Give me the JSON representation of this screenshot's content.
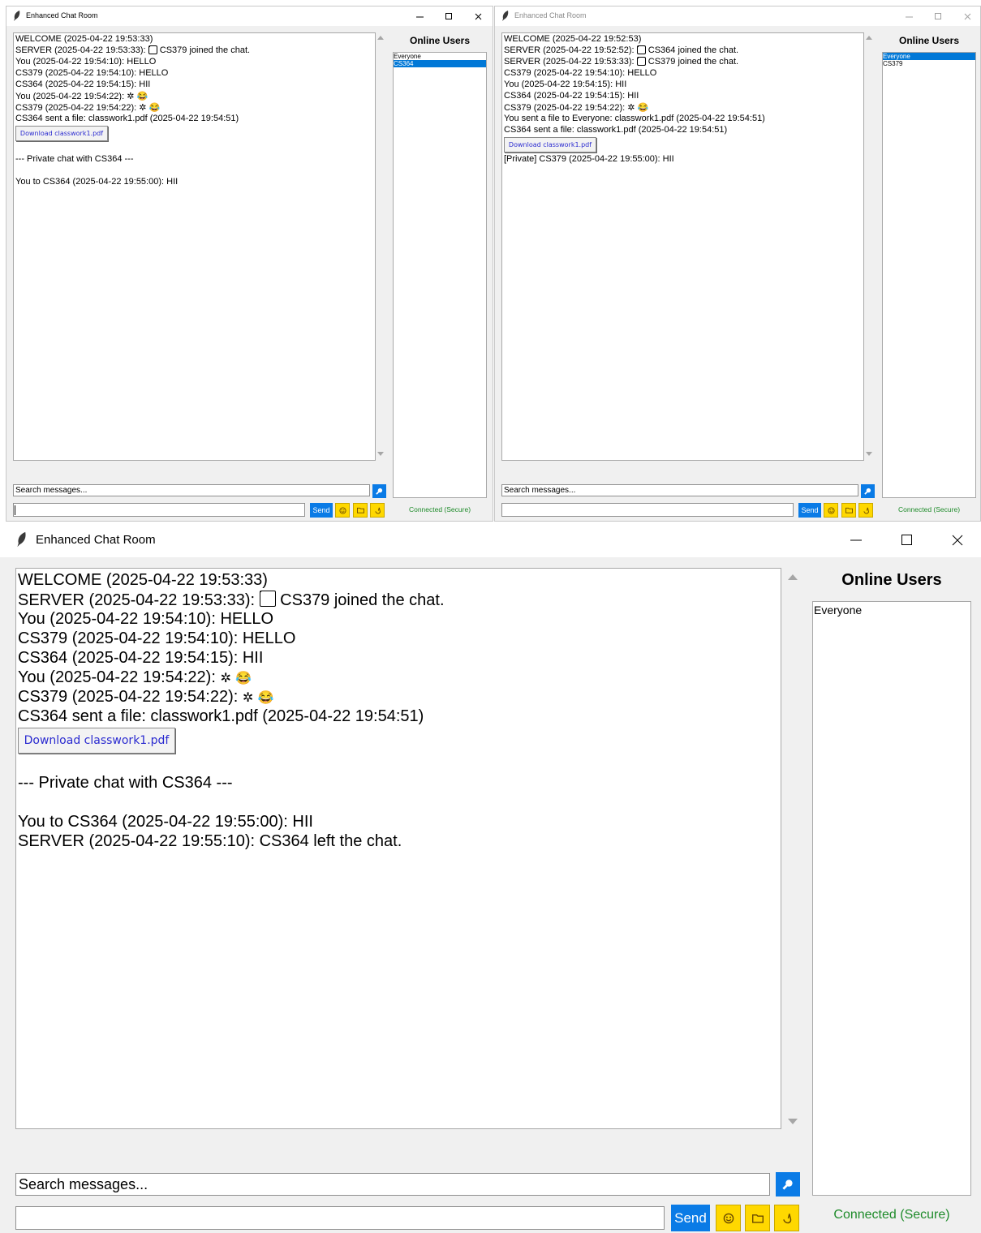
{
  "window1": {
    "title": "Enhanced Chat Room",
    "messages": [
      "WELCOME (2025-04-22 19:53:33)",
      "SERVER (2025-04-22 19:53:33): ",
      "You (2025-04-22 19:54:10): HELLO",
      "CS379 (2025-04-22 19:54:10): HELLO",
      "CS364 (2025-04-22 19:54:15): HII",
      "You (2025-04-22 19:54:22): ",
      "CS379 (2025-04-22 19:54:22): ",
      "CS364 sent a file: classwork1.pdf (2025-04-22 19:54:51)",
      "--- Private chat with CS364 ---",
      "You to CS364 (2025-04-22 19:55:00): HII"
    ],
    "server_join_text": "CS379 joined the chat.",
    "download_label": "Download classwork1.pdf",
    "online_users_title": "Online Users",
    "users": [
      "Everyone",
      "CS364"
    ],
    "selected_user": "CS364",
    "search_placeholder": "Search messages...",
    "send_label": "Send",
    "status": "Connected (Secure)"
  },
  "window2": {
    "title": "Enhanced Chat Room",
    "messages": [
      "WELCOME (2025-04-22 19:52:53)",
      "SERVER (2025-04-22 19:52:52): ",
      "SERVER (2025-04-22 19:53:33): ",
      "CS379 (2025-04-22 19:54:10): HELLO",
      "You (2025-04-22 19:54:15): HII",
      "CS364 (2025-04-22 19:54:15): HII",
      "CS379 (2025-04-22 19:54:22): ",
      "You sent a file to Everyone: classwork1.pdf (2025-04-22 19:54:51)",
      "CS364 sent a file: classwork1.pdf (2025-04-22 19:54:51)",
      "[Private] CS379 (2025-04-22 19:55:00): HII"
    ],
    "server_join_1": "CS364 joined the chat.",
    "server_join_2": "CS379 joined the chat.",
    "download_label": "Download classwork1.pdf",
    "online_users_title": "Online Users",
    "users": [
      "Everyone",
      "CS379"
    ],
    "selected_user": "Everyone",
    "search_placeholder": "Search messages...",
    "send_label": "Send",
    "status": "Connected (Secure)"
  },
  "window3": {
    "title": "Enhanced Chat Room",
    "messages": [
      "WELCOME (2025-04-22 19:53:33)",
      "SERVER (2025-04-22 19:53:33): ",
      "You (2025-04-22 19:54:10): HELLO",
      "CS379 (2025-04-22 19:54:10): HELLO",
      "CS364 (2025-04-22 19:54:15): HII",
      "You (2025-04-22 19:54:22): ",
      "CS379 (2025-04-22 19:54:22): ",
      "CS364 sent a file: classwork1.pdf (2025-04-22 19:54:51)",
      "--- Private chat with CS364 ---",
      "You to CS364 (2025-04-22 19:55:00): HII",
      "SERVER (2025-04-22 19:55:10): CS364 left the chat."
    ],
    "server_join_text": "CS379 joined the chat.",
    "download_label": "Download classwork1.pdf",
    "online_users_title": "Online Users",
    "users": [
      "Everyone"
    ],
    "search_placeholder": "Search messages...",
    "send_label": "Send",
    "status": "Connected (Secure)"
  },
  "icons": {
    "app": "feather-icon",
    "check": "check-box-icon",
    "sparkle": "sparkle-icon",
    "laugh": "laughing-face-icon",
    "search": "magnifier-icon",
    "emoji": "smiley-icon",
    "file": "folder-icon",
    "other": "hand-icon"
  },
  "colors": {
    "accent_blue": "#0a7be6",
    "selected_blue": "#0078d7",
    "yellow_button": "#ffd800",
    "status_green": "#1e8b2a",
    "download_link": "#2a2ad0"
  }
}
